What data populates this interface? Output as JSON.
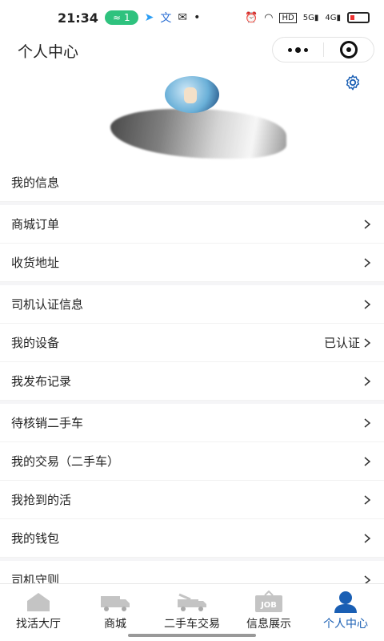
{
  "status_bar": {
    "time": "21:34",
    "pill": "1",
    "network": "HD",
    "sig1": "5G",
    "sig2": "4G"
  },
  "header": {
    "title": "个人中心"
  },
  "menu": {
    "items": [
      {
        "label": "我的信息",
        "value": "",
        "arrow": false
      },
      {
        "label": "商城订单",
        "value": "",
        "arrow": true
      },
      {
        "label": "收货地址",
        "value": "",
        "arrow": true
      },
      {
        "label": "司机认证信息",
        "value": "",
        "arrow": true
      },
      {
        "label": "我的设备",
        "value": "已认证",
        "arrow": true
      },
      {
        "label": "我发布记录",
        "value": "",
        "arrow": true
      },
      {
        "label": "待核销二手车",
        "value": "",
        "arrow": true
      },
      {
        "label": "我的交易（二手车）",
        "value": "",
        "arrow": true
      },
      {
        "label": "我抢到的活",
        "value": "",
        "arrow": true
      },
      {
        "label": "我的钱包",
        "value": "",
        "arrow": true
      },
      {
        "label": "司机守则",
        "value": "",
        "arrow": true
      }
    ]
  },
  "tabbar": {
    "tabs": [
      {
        "label": "找活大厅",
        "icon": "house-icon"
      },
      {
        "label": "商城",
        "icon": "truck-icon"
      },
      {
        "label": "二手车交易",
        "icon": "crane-truck-icon"
      },
      {
        "label": "信息展示",
        "icon": "job-board-icon",
        "badge": "JOB"
      },
      {
        "label": "个人中心",
        "icon": "person-icon",
        "active": true
      }
    ]
  },
  "colors": {
    "accent": "#1a5fb4",
    "pill_green": "#2ec27e",
    "inactive_icon": "#c4c4c4"
  }
}
